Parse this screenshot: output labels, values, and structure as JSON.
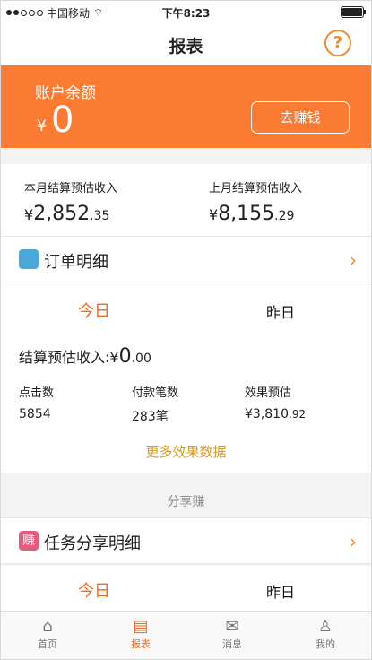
{
  "status": {
    "carrier": "中国移动",
    "time": "下午8:23"
  },
  "nav": {
    "title": "报表",
    "help_icon": "question-circle-icon"
  },
  "balance": {
    "label": "账户余额",
    "currency": "¥",
    "amount": "0",
    "button": "去赚钱"
  },
  "monthly": {
    "this_month": {
      "label": "本月结算预估收入",
      "currency": "¥",
      "integer": "2,852",
      "decimal": ".35"
    },
    "last_month": {
      "label": "上月结算预估收入",
      "currency": "¥",
      "integer": "8,155",
      "decimal": ".29"
    }
  },
  "order_detail": {
    "label": "订单明细"
  },
  "tabs": {
    "today": "今日",
    "yesterday": "昨日"
  },
  "estimate": {
    "label": "结算预估收入:",
    "currency": "¥",
    "integer": "0",
    "decimal": ".00"
  },
  "stats": [
    {
      "label": "点击数",
      "value": "5854"
    },
    {
      "label": "付款笔数",
      "value": "283笔"
    },
    {
      "label": "效果预估",
      "currency": "¥",
      "integer": "3,810",
      "decimal": ".92"
    }
  ],
  "more_link": "更多效果数据",
  "share": {
    "section_title": "分享赚",
    "task_icon_text": "赚",
    "task_label": "任务分享明细"
  },
  "tabbar": [
    {
      "label": "首页",
      "icon": "home-icon"
    },
    {
      "label": "报表",
      "icon": "report-icon"
    },
    {
      "label": "消息",
      "icon": "mail-icon"
    },
    {
      "label": "我的",
      "icon": "user-icon"
    }
  ],
  "colors": {
    "accent": "#fb7b32",
    "active_text": "#f06a1f",
    "link": "#d69a1f"
  }
}
